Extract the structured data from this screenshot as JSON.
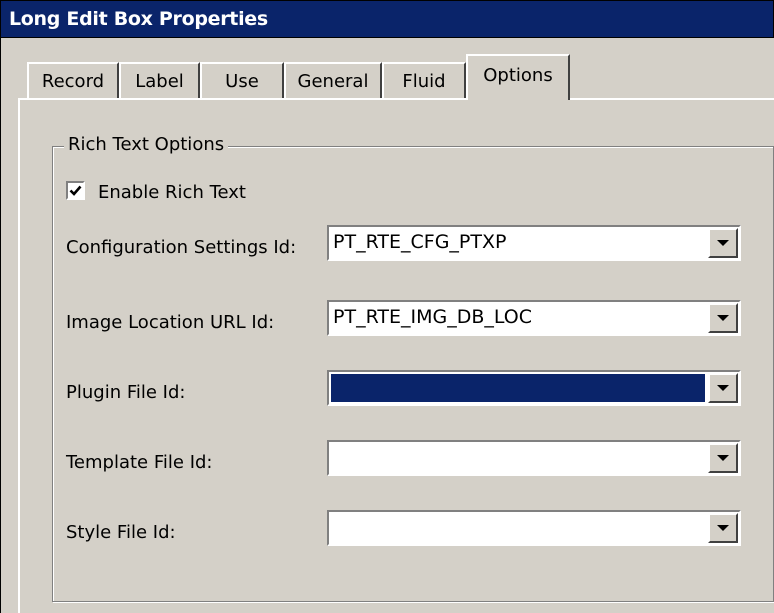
{
  "window": {
    "title": "Long Edit Box Properties"
  },
  "tabs": [
    {
      "label": "Record"
    },
    {
      "label": "Label"
    },
    {
      "label": "Use"
    },
    {
      "label": "General"
    },
    {
      "label": "Fluid"
    },
    {
      "label": "Options",
      "active": true
    }
  ],
  "rich_text": {
    "group_title": "Rich Text Options",
    "enable_label": "Enable Rich Text",
    "enable_checked": true,
    "fields": [
      {
        "label": "Configuration Settings Id:",
        "value": "PT_RTE_CFG_PTXP"
      },
      {
        "label": "Image Location URL Id:",
        "value": "PT_RTE_IMG_DB_LOC"
      },
      {
        "label": "Plugin File Id:",
        "value": "",
        "selected": true
      },
      {
        "label": "Template File Id:",
        "value": ""
      },
      {
        "label": "Style File Id:",
        "value": ""
      }
    ]
  },
  "icons": {
    "checkbox": "check-icon",
    "dropdown": "chevron-down-icon"
  },
  "colors": {
    "titlebar": "#0a246a",
    "face": "#d4d0c8",
    "selection": "#0a246a"
  }
}
